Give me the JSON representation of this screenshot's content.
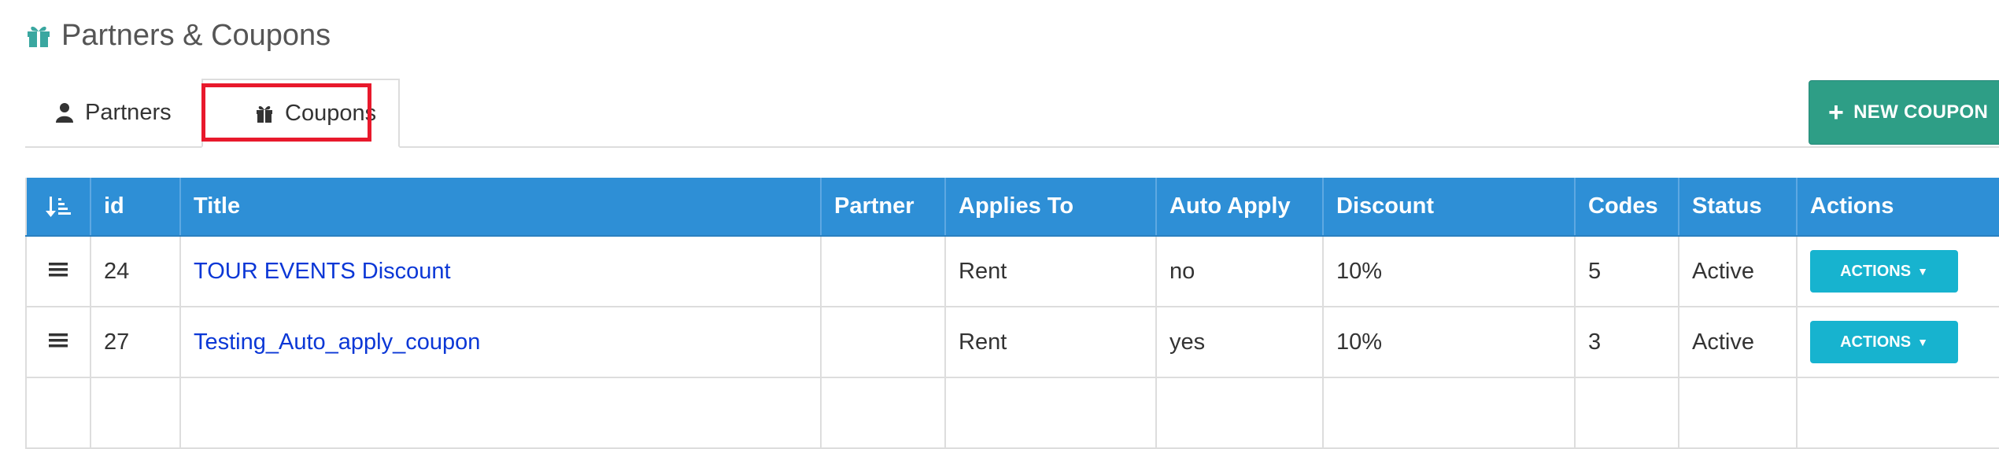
{
  "page": {
    "title": "Partners & Coupons",
    "icon": "gift-icon"
  },
  "tabs": [
    {
      "label": "Partners",
      "icon": "user-icon",
      "active": false
    },
    {
      "label": "Coupons",
      "icon": "gift-icon",
      "active": true
    }
  ],
  "toolbar": {
    "new_coupon_label": "NEW COUPON",
    "new_coupon_icon": "plus-icon"
  },
  "table": {
    "sort_icon": "sort-amount-icon",
    "columns": [
      "id",
      "Title",
      "Partner",
      "Applies To",
      "Auto Apply",
      "Discount",
      "Codes",
      "Status",
      "Actions"
    ],
    "rows": [
      {
        "id": "24",
        "title": "TOUR EVENTS Discount",
        "partner": "",
        "applies_to": "Rent",
        "auto_apply": "no",
        "discount": "10%",
        "codes": "5",
        "status": "Active",
        "actions_label": "ACTIONS"
      },
      {
        "id": "27",
        "title": "Testing_Auto_apply_coupon",
        "partner": "",
        "applies_to": "Rent",
        "auto_apply": "yes",
        "discount": "10%",
        "codes": "3",
        "status": "Active",
        "actions_label": "ACTIONS"
      }
    ]
  },
  "colors": {
    "header_bg": "#2e8fd6",
    "new_coupon_bg": "#2e9e86",
    "actions_bg": "#17b3cf",
    "link": "#0b37d6",
    "highlight": "#e8192c"
  }
}
